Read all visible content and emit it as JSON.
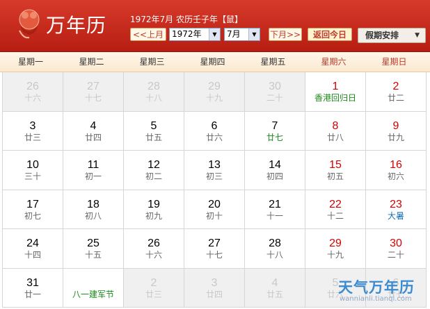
{
  "header": {
    "logo_text": "万年历",
    "info_text": "1972年7月 农历壬子年【鼠】",
    "prev_month": "<<上月",
    "year_value": "1972年",
    "month_value": "7月",
    "next_month": "下月>>",
    "today_button": "返回今日",
    "holiday_button": "假期安排"
  },
  "weekdays": [
    "星期一",
    "星期二",
    "星期三",
    "星期四",
    "星期五",
    "星期六",
    "星期日"
  ],
  "weeks": [
    [
      {
        "day": "26",
        "lunar": "十六",
        "dim": true
      },
      {
        "day": "27",
        "lunar": "十七",
        "dim": true
      },
      {
        "day": "28",
        "lunar": "十八",
        "dim": true
      },
      {
        "day": "29",
        "lunar": "十九",
        "dim": true
      },
      {
        "day": "30",
        "lunar": "二十",
        "dim": true
      },
      {
        "day": "1",
        "lunar": "香港回归日",
        "type": "hol"
      },
      {
        "day": "2",
        "lunar": "廿二"
      }
    ],
    [
      {
        "day": "3",
        "lunar": "廿三"
      },
      {
        "day": "4",
        "lunar": "廿四"
      },
      {
        "day": "5",
        "lunar": "廿五"
      },
      {
        "day": "6",
        "lunar": "廿六"
      },
      {
        "day": "7",
        "lunar": "廿七",
        "type": "hol"
      },
      {
        "day": "8",
        "lunar": "廿八"
      },
      {
        "day": "9",
        "lunar": "廿九"
      }
    ],
    [
      {
        "day": "10",
        "lunar": "三十"
      },
      {
        "day": "11",
        "lunar": "初一"
      },
      {
        "day": "12",
        "lunar": "初二"
      },
      {
        "day": "13",
        "lunar": "初三"
      },
      {
        "day": "14",
        "lunar": "初四"
      },
      {
        "day": "15",
        "lunar": "初五"
      },
      {
        "day": "16",
        "lunar": "初六"
      }
    ],
    [
      {
        "day": "17",
        "lunar": "初七"
      },
      {
        "day": "18",
        "lunar": "初八"
      },
      {
        "day": "19",
        "lunar": "初九"
      },
      {
        "day": "20",
        "lunar": "初十"
      },
      {
        "day": "21",
        "lunar": "十一"
      },
      {
        "day": "22",
        "lunar": "十二"
      },
      {
        "day": "23",
        "lunar": "大暑",
        "type": "term"
      }
    ],
    [
      {
        "day": "24",
        "lunar": "十四"
      },
      {
        "day": "25",
        "lunar": "十五"
      },
      {
        "day": "26",
        "lunar": "十六"
      },
      {
        "day": "27",
        "lunar": "十七"
      },
      {
        "day": "28",
        "lunar": "十八"
      },
      {
        "day": "29",
        "lunar": "十九"
      },
      {
        "day": "30",
        "lunar": "二十"
      }
    ],
    [
      {
        "day": "31",
        "lunar": "廿一"
      },
      {
        "day": "",
        "lunar": "八一建军节",
        "type": "hol"
      },
      {
        "day": "2",
        "lunar": "廿三",
        "dim": true
      },
      {
        "day": "3",
        "lunar": "廿四",
        "dim": true
      },
      {
        "day": "4",
        "lunar": "廿五",
        "dim": true
      },
      {
        "day": "5",
        "lunar": "廿六",
        "dim": true
      },
      {
        "day": "6",
        "lunar": "廿七",
        "dim": true
      }
    ]
  ],
  "watermark": {
    "title": "天气万年历",
    "url": "wannianli.tianqi.com"
  },
  "colors": {
    "header_red": "#c62a1b",
    "weekend_red": "#d40000",
    "holiday_green": "#1a8a1a",
    "solar_term_blue": "#1a6fb0"
  }
}
